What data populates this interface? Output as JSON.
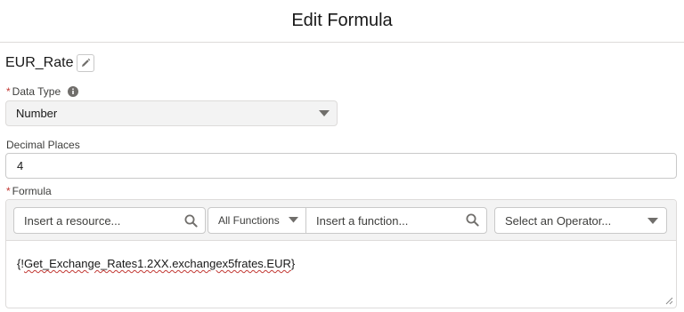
{
  "header": {
    "title": "Edit Formula"
  },
  "resource": {
    "name": "EUR_Rate"
  },
  "data_type": {
    "required_mark": "*",
    "label": "Data Type",
    "value": "Number"
  },
  "decimal_places": {
    "label": "Decimal Places",
    "value": "4"
  },
  "formula": {
    "required_mark": "*",
    "label": "Formula",
    "resource_placeholder": "Insert a resource...",
    "function_category": "All Functions",
    "function_placeholder": "Insert a function...",
    "operator_placeholder": "Select an Operator...",
    "expression_prefix": "{!",
    "expression_body": "Get_Exchange_Rates1.2XX.exchangex5frates.EUR",
    "expression_suffix": "}"
  },
  "icons": [
    "pencil-icon",
    "info-icon",
    "chevron-down-icon",
    "search-icon",
    "resize-handle-icon"
  ],
  "colors": {
    "required": "#c23934",
    "border": "#c9c9c9",
    "toolbar_bg": "#f3f3f3"
  }
}
